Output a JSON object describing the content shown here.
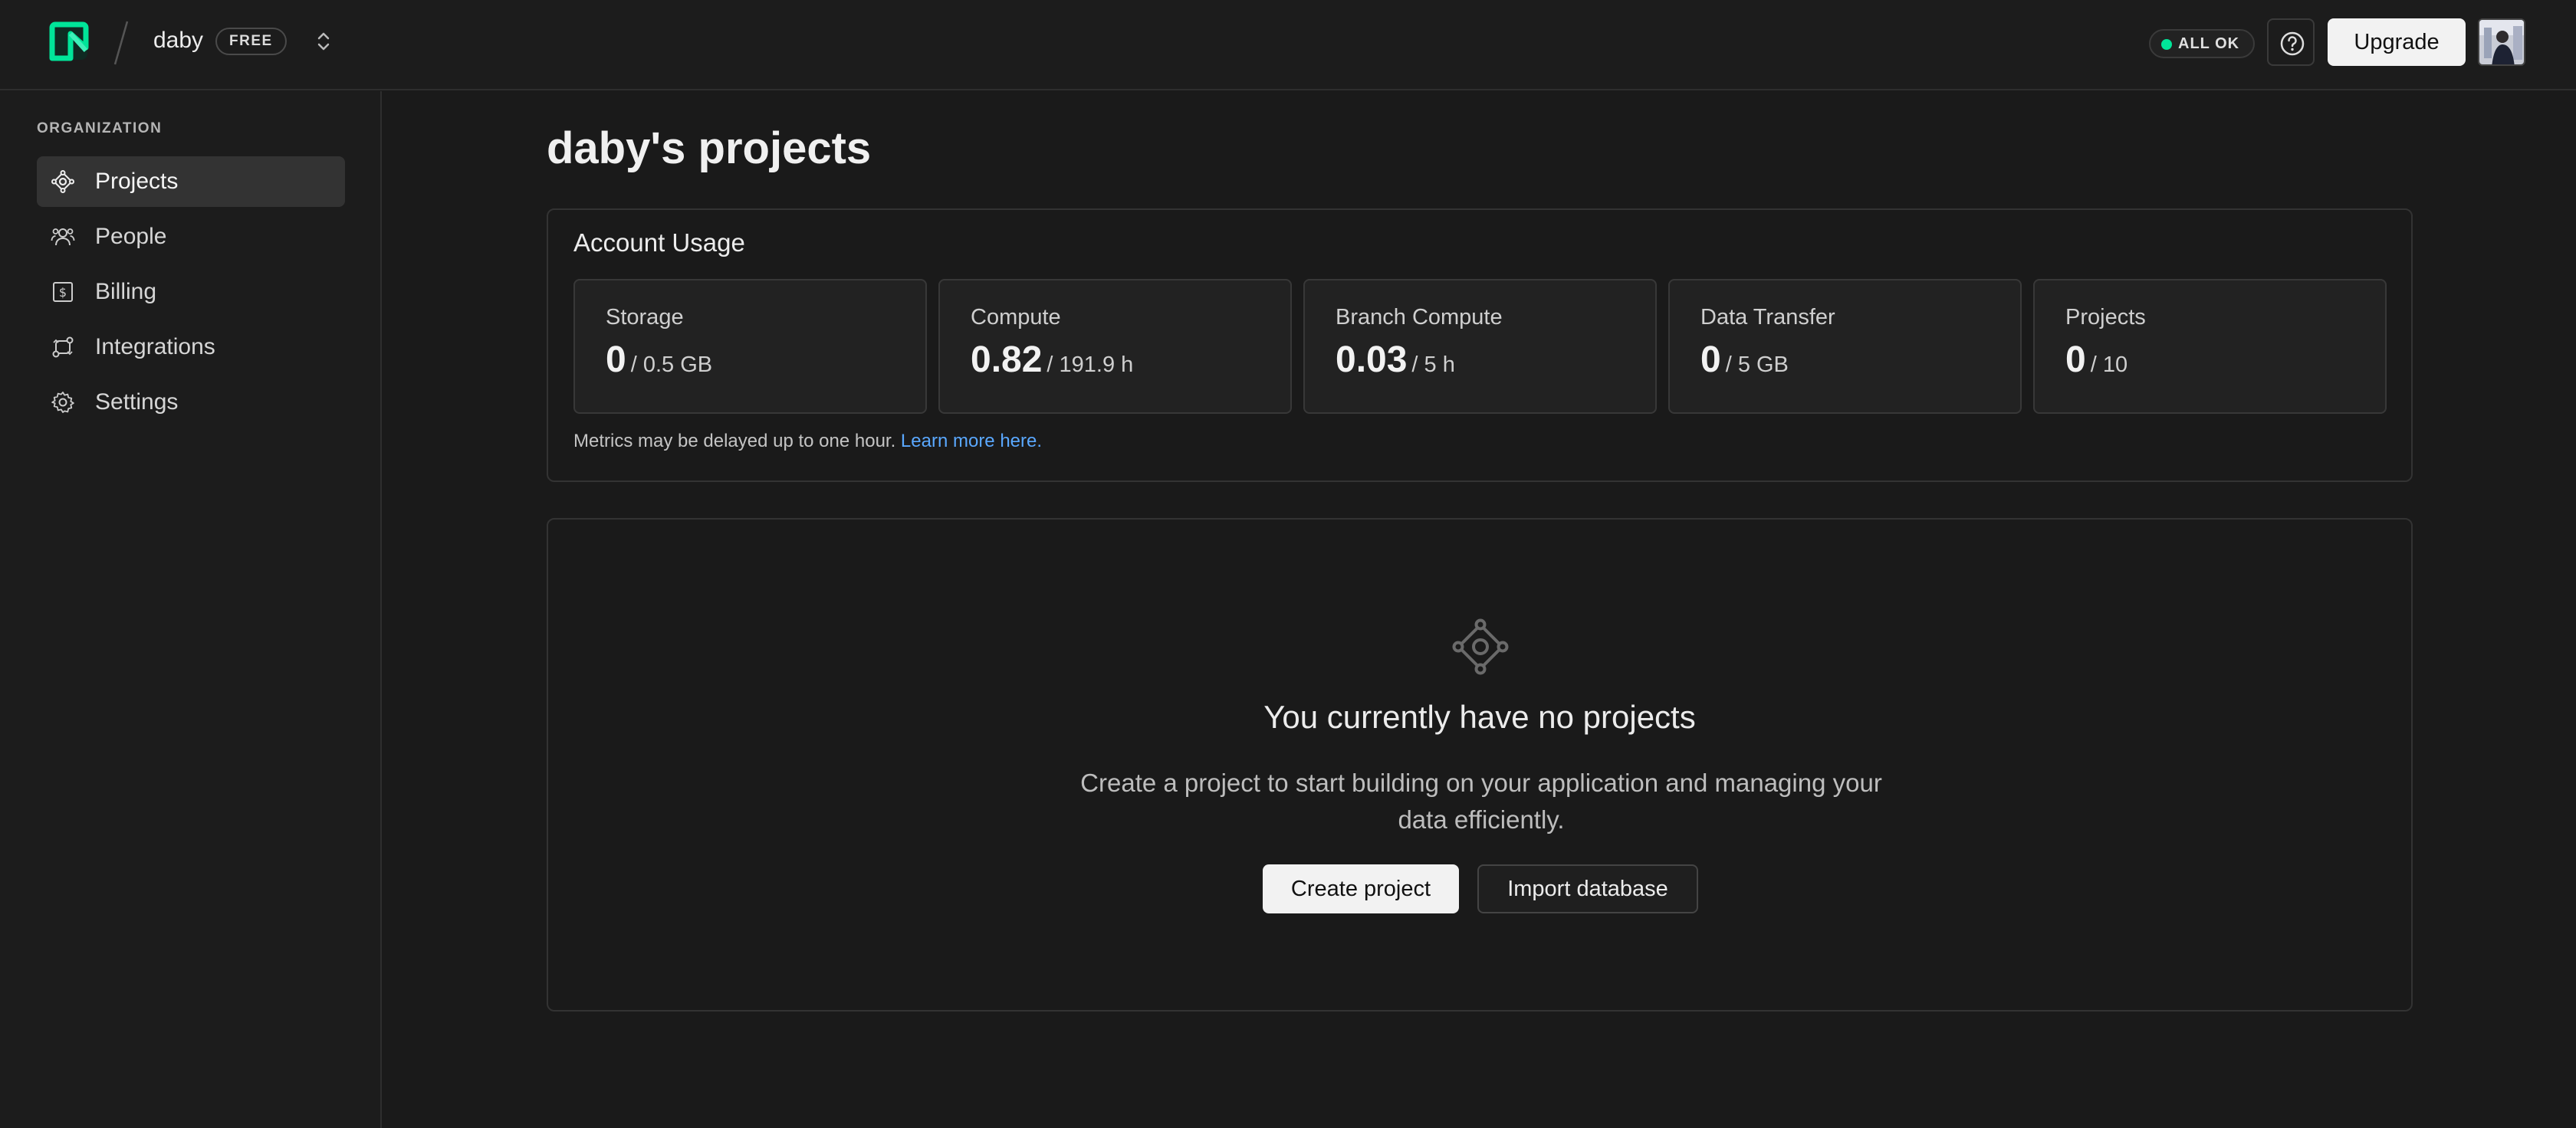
{
  "header": {
    "org_name": "daby",
    "plan_badge": "FREE",
    "status": "ALL OK",
    "upgrade_label": "Upgrade"
  },
  "sidebar": {
    "heading": "ORGANIZATION",
    "items": [
      {
        "label": "Projects",
        "icon": "projects-icon",
        "active": true
      },
      {
        "label": "People",
        "icon": "people-icon",
        "active": false
      },
      {
        "label": "Billing",
        "icon": "billing-icon",
        "active": false
      },
      {
        "label": "Integrations",
        "icon": "integrations-icon",
        "active": false
      },
      {
        "label": "Settings",
        "icon": "gear-icon",
        "active": false
      }
    ]
  },
  "main": {
    "title": "daby's projects",
    "usage": {
      "title": "Account Usage",
      "metrics": [
        {
          "label": "Storage",
          "value": "0",
          "limit": "/ 0.5 GB"
        },
        {
          "label": "Compute",
          "value": "0.82",
          "limit": "/ 191.9 h"
        },
        {
          "label": "Branch Compute",
          "value": "0.03",
          "limit": "/ 5 h"
        },
        {
          "label": "Data Transfer",
          "value": "0",
          "limit": "/ 5 GB"
        },
        {
          "label": "Projects",
          "value": "0",
          "limit": "/ 10"
        }
      ],
      "note": "Metrics may be delayed up to one hour.",
      "note_link": "Learn more here."
    },
    "empty_state": {
      "title": "You currently have no projects",
      "description": "Create a project to start building on your application and managing your data efficiently.",
      "create_label": "Create project",
      "import_label": "Import database"
    }
  },
  "colors": {
    "background": "#1a1a1a",
    "accent": "#00e599",
    "link": "#5aa8ff"
  }
}
